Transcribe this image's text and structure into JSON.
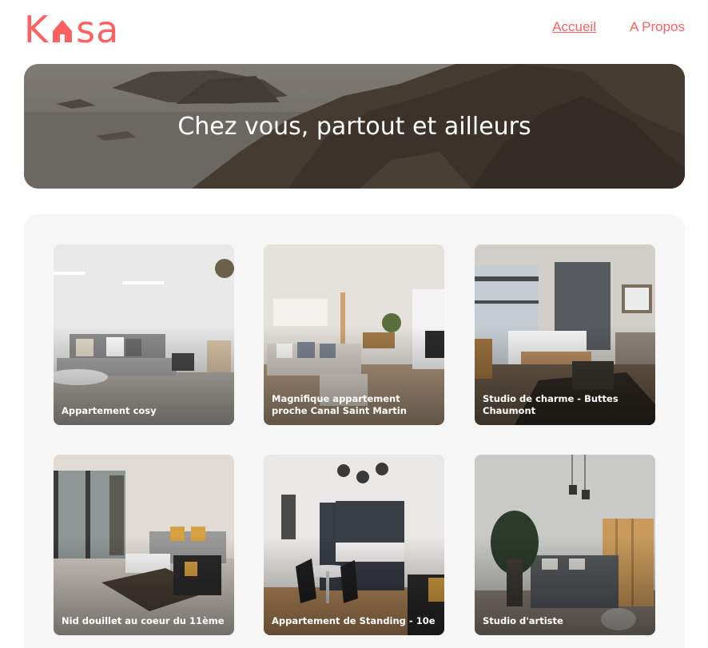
{
  "header": {
    "logo": "Kasa",
    "nav": [
      {
        "label": "Accueil",
        "active": true
      },
      {
        "label": "A Propos",
        "active": false
      }
    ]
  },
  "banner": {
    "title": "Chez vous, partout et ailleurs",
    "image": "coastal-cliffs"
  },
  "listings": [
    {
      "title": "Appartement cosy",
      "image": "living-room-white"
    },
    {
      "title": "Magnifique appartement proche Canal Saint Martin",
      "image": "living-room-beige"
    },
    {
      "title": "Studio de charme - Buttes Chaumont",
      "image": "bedroom-studio"
    },
    {
      "title": "Nid douillet au coeur du 11ème",
      "image": "living-room-window"
    },
    {
      "title": "Appartement de Standing - 10e",
      "image": "kitchen-dining"
    },
    {
      "title": "Studio d'artiste",
      "image": "bedroom-plants"
    }
  ],
  "colors": {
    "accent": "#ff6060",
    "gallery_bg": "#f6f6f6"
  }
}
